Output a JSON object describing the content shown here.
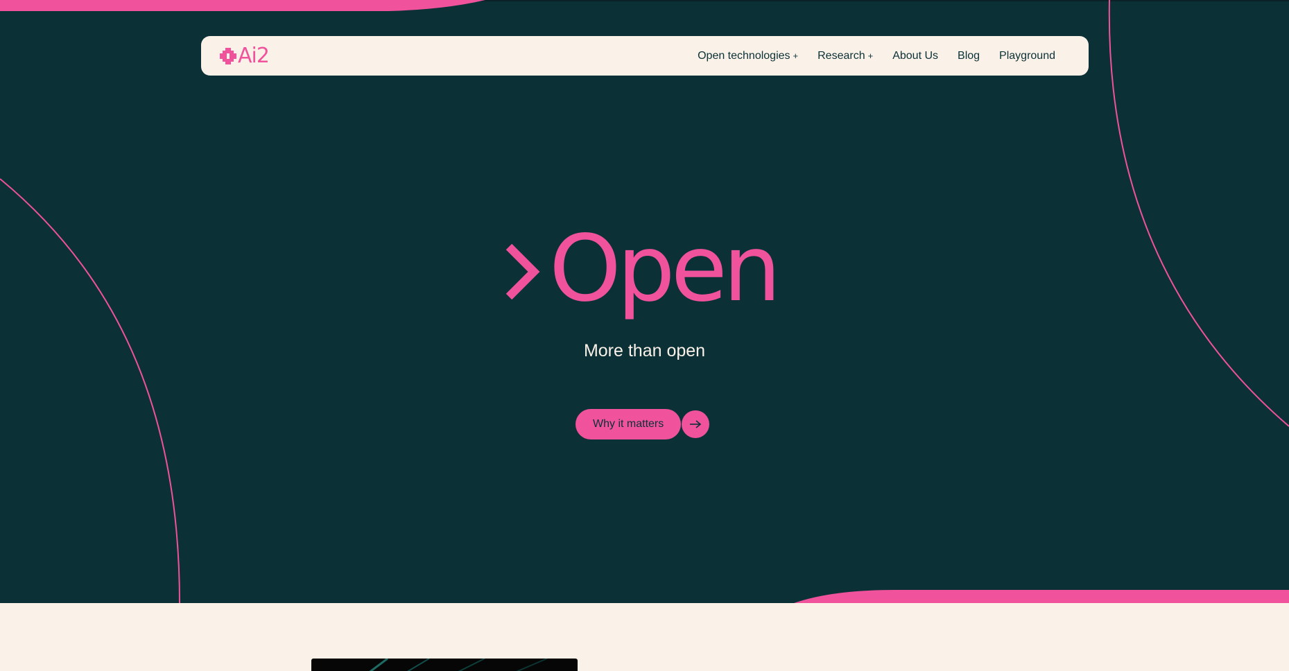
{
  "brand": {
    "logo_text": "Ai2",
    "logo_icon": "asterisk-logo-icon"
  },
  "nav": {
    "items": [
      {
        "label": "Open technologies",
        "has_submenu": true,
        "indicator": "+"
      },
      {
        "label": "Research",
        "has_submenu": true,
        "indicator": "+"
      },
      {
        "label": "About Us",
        "has_submenu": false
      },
      {
        "label": "Blog",
        "has_submenu": false
      },
      {
        "label": "Playground",
        "has_submenu": false
      }
    ]
  },
  "hero": {
    "headline": "Open",
    "headline_prefix_icon": "chevron-right-icon",
    "subtitle": "More than open",
    "cta_label": "Why it matters",
    "cta_icon": "arrow-right-icon"
  },
  "colors": {
    "accent": "#f0529c",
    "hero_background": "#0b3036",
    "cream": "#faf2e9"
  }
}
